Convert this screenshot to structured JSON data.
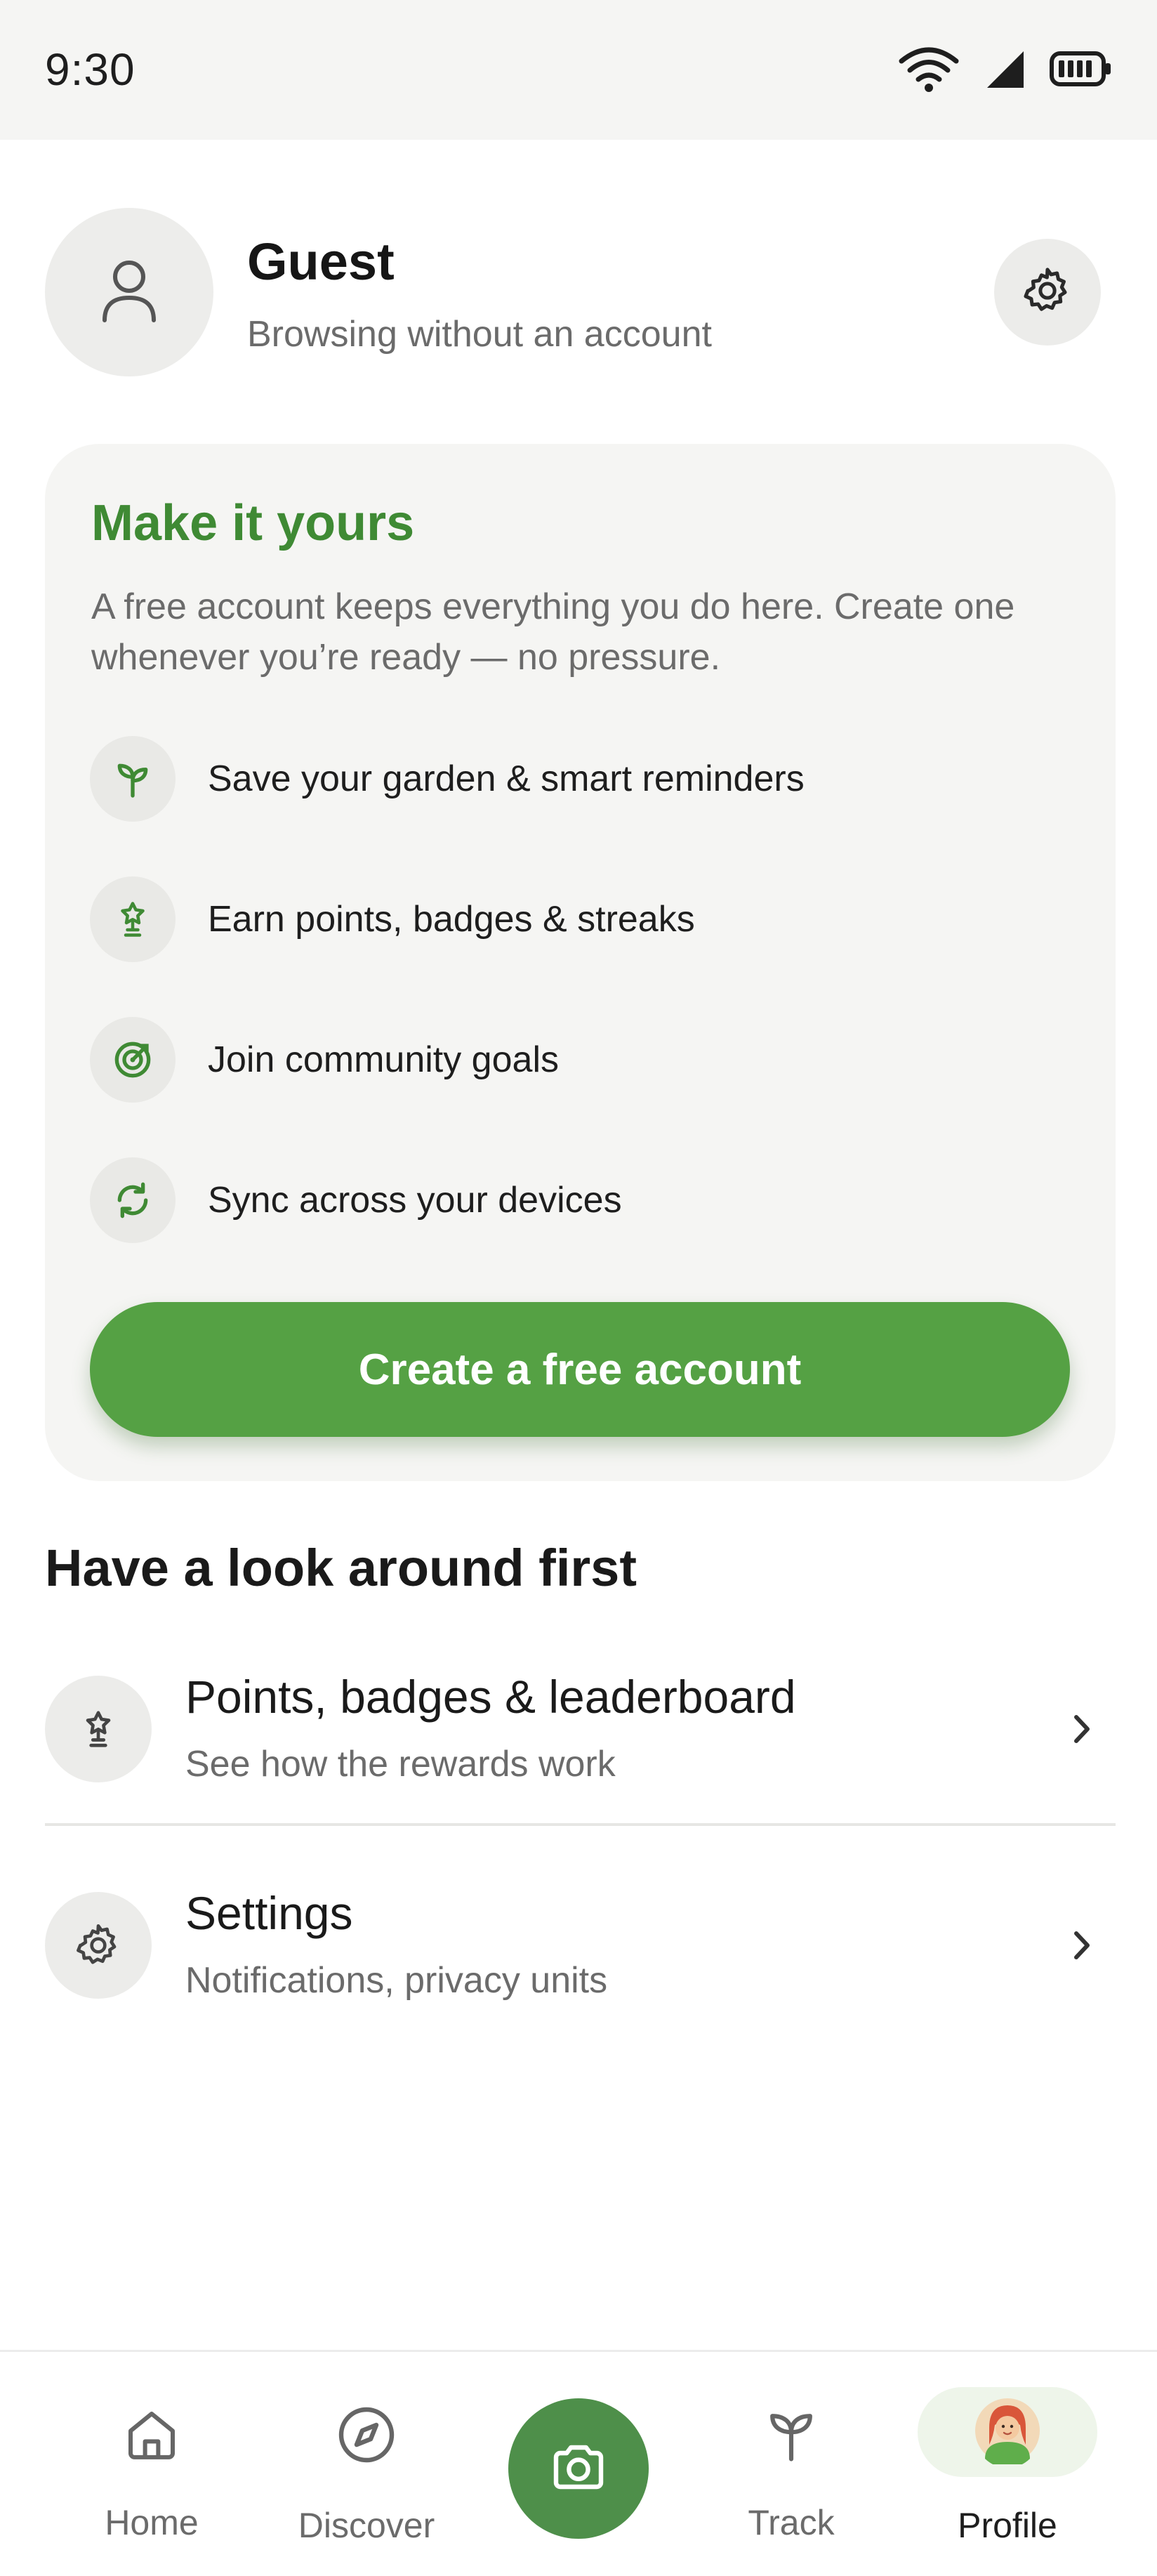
{
  "status_bar": {
    "time": "9:30",
    "icons": [
      "wifi-icon",
      "signal-icon",
      "battery-icon"
    ]
  },
  "profile": {
    "name": "Guest",
    "subtitle": "Browsing without an account",
    "avatar_icon": "person-icon",
    "settings_icon": "gear-icon"
  },
  "card": {
    "title": "Make it yours",
    "description": "A free account keeps everything you do here. Create one whenever you’re ready — no pressure.",
    "benefits": [
      {
        "icon": "sprout-icon",
        "label": "Save your garden & smart reminders"
      },
      {
        "icon": "trophy-icon",
        "label": "Earn points, badges & streaks"
      },
      {
        "icon": "target-icon",
        "label": "Join community goals"
      },
      {
        "icon": "sync-icon",
        "label": "Sync across your devices"
      }
    ],
    "cta_label": "Create a free account"
  },
  "look_around": {
    "title": "Have a look around first",
    "items": [
      {
        "icon": "trophy-icon",
        "title": "Points, badges & leaderboard",
        "subtitle": "See how the rewards work"
      },
      {
        "icon": "gear-icon",
        "title": "Settings",
        "subtitle": "Notifications, privacy units"
      }
    ]
  },
  "bottom_nav": {
    "items": [
      {
        "icon": "home-icon",
        "label": "Home"
      },
      {
        "icon": "compass-icon",
        "label": "Discover"
      },
      {
        "icon": "camera-icon",
        "label": ""
      },
      {
        "icon": "sprout-icon",
        "label": "Track"
      },
      {
        "icon": "avatar-icon",
        "label": "Profile"
      }
    ],
    "active": "Profile"
  },
  "colors": {
    "accent_green": "#55a144",
    "title_green": "#3f8a34",
    "camera_green": "#4e8f4a",
    "card_background": "#f5f5f3"
  }
}
